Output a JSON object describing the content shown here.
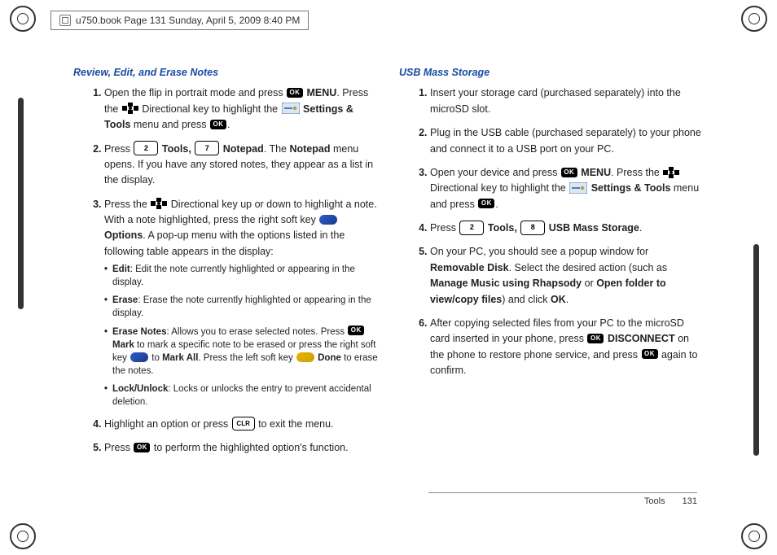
{
  "header_crop": "u750.book  Page 131  Sunday, April 5, 2009  8:40 PM",
  "left": {
    "title": "Review, Edit, and Erase Notes",
    "s1a": "Open the flip in portrait mode and press ",
    "s1b": " MENU",
    "s1c": ". Press the ",
    "s1d": " Directional key to highlight the ",
    "s1e": " Settings & Tools",
    "s1f": " menu and press ",
    "s2a": "Press ",
    "s2b": " Tools, ",
    "s2c": " Notepad",
    "s2d": ". The ",
    "s2e": "Notepad",
    "s2f": " menu opens. If you have any stored notes, they appear as a list in the display.",
    "s3a": "Press the ",
    "s3b": " Directional key up or down to highlight a note. With a note highlighted, press the right soft key ",
    "s3c": " Options",
    "s3d": ". A pop-up menu with the options listed in the following table appears in the display:",
    "b1a": "Edit",
    "b1b": ": Edit the note currently highlighted or appearing in the display.",
    "b2a": "Erase",
    "b2b": ": Erase the note currently highlighted or appearing in the display.",
    "b3a": "Erase Notes",
    "b3b": ": Allows you to erase selected notes. Press ",
    "b3c": " Mark",
    "b3d": " to mark a specific note to be erased or press the right soft key ",
    "b3e": " to ",
    "b3f": "Mark All",
    "b3g": ". Press the left soft key ",
    "b3h": " Done",
    "b3i": " to erase the notes.",
    "b4a": "Lock/Unlock",
    "b4b": ": Locks or unlocks the entry to prevent accidental deletion.",
    "s4a": "Highlight an option or press ",
    "s4b": " to exit the menu.",
    "s5a": "Press ",
    "s5b": " to perform the highlighted option's function."
  },
  "right": {
    "title": "USB Mass Storage",
    "s1": "Insert your storage card (purchased separately) into the microSD slot.",
    "s2": "Plug in the USB cable (purchased separately) to your phone and connect it to a USB port on your PC.",
    "s3a": "Open your device and press ",
    "s3b": " MENU",
    "s3c": ". Press the ",
    "s3d": " Directional key to highlight the ",
    "s3e": " Settings & Tools",
    "s3f": " menu and press ",
    "s4a": "Press ",
    "s4b": " Tools, ",
    "s4c": " USB Mass Storage",
    "s5a": "On your PC, you should see a popup window for ",
    "s5b": "Removable Disk",
    "s5c": ".  Select the desired action (such as ",
    "s5d": "Manage Music using Rhapsody",
    "s5e": " or ",
    "s5f": "Open folder to view/copy files",
    "s5g": ") and click ",
    "s5h": "OK",
    "s6a": "After copying selected files from your PC to the microSD card inserted in your phone, press ",
    "s6b": " DISCONNECT",
    "s6c": " on the phone to restore phone service, and press ",
    "s6d": " again to confirm."
  },
  "key2": "2",
  "key7": "7",
  "key8": "8",
  "ok_label": "OK",
  "clr_label": "CLR",
  "footer_label": "Tools",
  "footer_page": "131"
}
